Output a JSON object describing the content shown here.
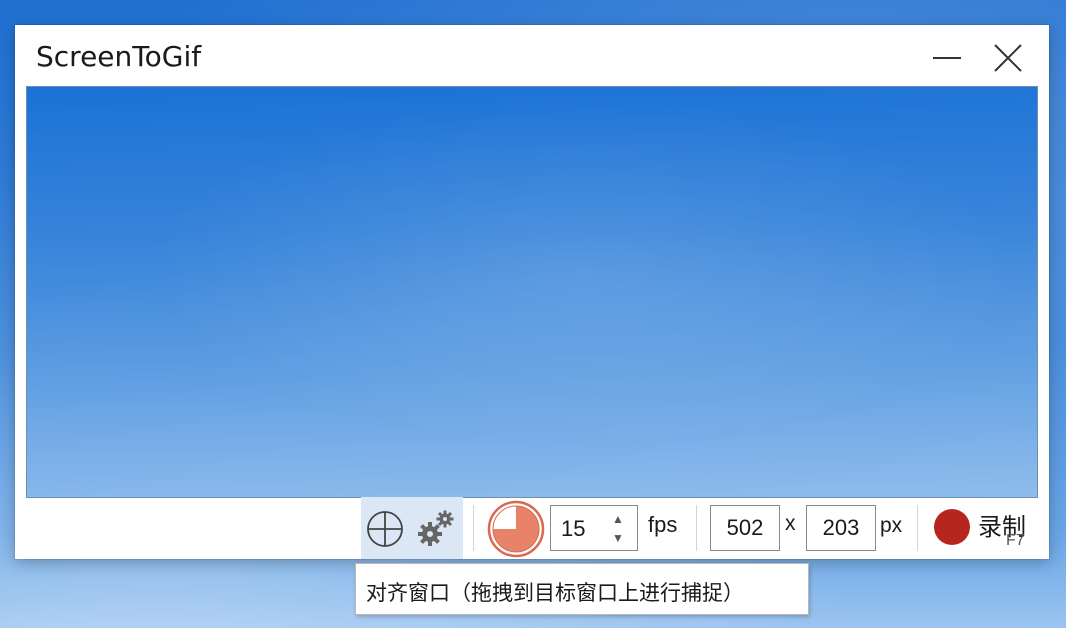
{
  "window": {
    "title": "ScreenToGif"
  },
  "titlebar_buttons": {
    "minimize_icon": "minimize-icon",
    "close_icon": "close-icon"
  },
  "toolbar": {
    "snap_icons": [
      "crosshair-icon",
      "gears-icon"
    ],
    "timer_icon": "timer-icon",
    "fps_value": "15",
    "fps_unit": "fps",
    "width_value": "502",
    "times_sign": "x",
    "height_value": "203",
    "size_unit": "px",
    "record_label": "录制",
    "record_shortcut": "F7"
  },
  "tooltip": {
    "text": "对齐窗口（拖拽到目标窗口上进行捕捉）"
  },
  "colors": {
    "record": "#b5261e",
    "timer": "#e8836a",
    "snap_highlight": "#dbe7f5",
    "desktop": "#2e7ed8"
  }
}
